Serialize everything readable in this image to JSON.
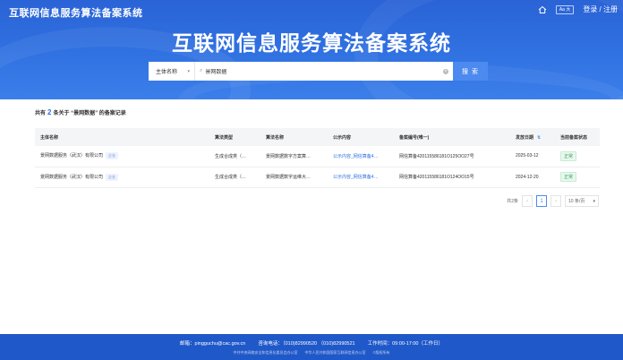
{
  "header": {
    "brand": "互联网信息服务算法备案系统",
    "font_toggle": "Aa 大",
    "login": "登录 / 注册",
    "title": "互联网信息服务算法备案系统"
  },
  "search": {
    "scope": "主体名称",
    "query": "景网数据",
    "button": "搜 索"
  },
  "summary": {
    "prefix": "共有",
    "count": "2",
    "suffix": "条关于 “景网数据” 的备案记录"
  },
  "table": {
    "headers": [
      "主体名称",
      "算法类型",
      "算法名称",
      "公示内容",
      "备案编号(唯一)",
      "发放日期",
      "当前备案状态"
    ],
    "rows": [
      {
        "entity": "景网数据服务（武汉）有限公司",
        "tag": "企业",
        "type": "生成合成类（…",
        "name": "景网数据数字方案算…",
        "content": "公示内容_网信算备4…",
        "code": "网信算备420115586181O125OO27号",
        "date": "2025-03-12",
        "status": "正常"
      },
      {
        "entity": "景网数据服务（武汉）有限公司",
        "tag": "企业",
        "type": "生成合成类（…",
        "name": "景网数据数字运维大…",
        "content": "公示内容_网信算备4…",
        "code": "网信算备420115586181O124OO15号",
        "date": "2024-12-20",
        "status": "正常"
      }
    ]
  },
  "pagination": {
    "total": "共2条",
    "current": "1",
    "page_size": "10 条/页"
  },
  "footer": {
    "email": "邮箱：pingguchu@cac.gov.cn",
    "phone": "咨询电话：（010)82990520  （010)82990521",
    "hours": "工作时间：09:00-17:00（工作日）",
    "org1": "中共中央网络安全和信息化委员会办公室",
    "org2": "中华人民共和国国家互联网信息办公室",
    "copyright": "©版权所有"
  }
}
